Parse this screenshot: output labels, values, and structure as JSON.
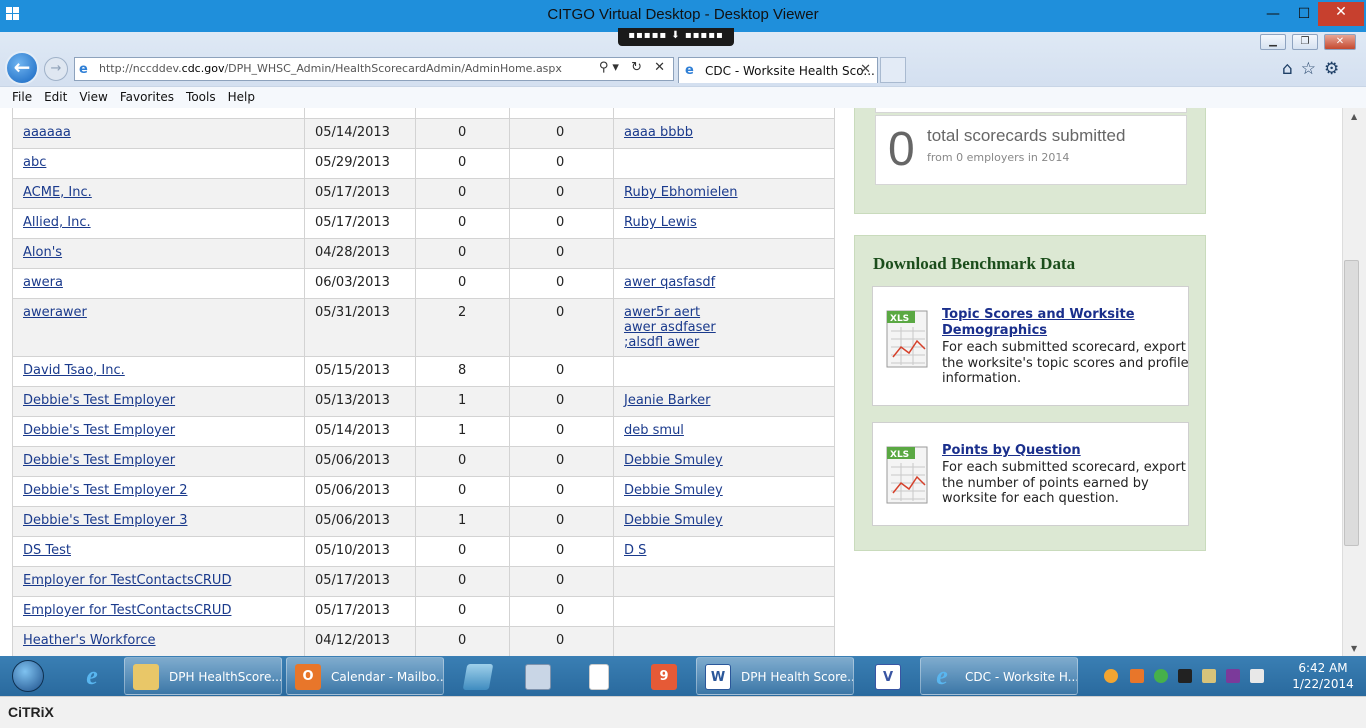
{
  "window": {
    "title": "CITGO Virtual Desktop - Desktop Viewer",
    "min_glyph": "—",
    "max_glyph": "☐",
    "close_glyph": "✕",
    "handle_glyph": "▪▪▪▪▪ ⬇ ▪▪▪▪▪"
  },
  "browser": {
    "url_prefix": "http://nccddev.",
    "url_domain": "cdc.gov",
    "url_suffix": "/DPH_WHSC_Admin/HealthScorecardAdmin/AdminHome.aspx",
    "address_icons": "⚲▾ ↻ ✕",
    "tab_label": "CDC - Worksite Health Sco...",
    "tab_close": "✕",
    "back_glyph": "←",
    "forward_glyph": "→",
    "right_icons": "⌂☆⚙",
    "menu": [
      "File",
      "Edit",
      "View",
      "Favorites",
      "Tools",
      "Help"
    ]
  },
  "employers": {
    "rows": [
      {
        "name": "aaaaaa",
        "date": "05/14/2013",
        "n1": "0",
        "n2": "0",
        "contacts": [
          "aaaa bbbb"
        ]
      },
      {
        "name": "abc",
        "date": "05/29/2013",
        "n1": "0",
        "n2": "0",
        "contacts": []
      },
      {
        "name": "ACME, Inc.",
        "date": "05/17/2013",
        "n1": "0",
        "n2": "0",
        "contacts": [
          "Ruby Ebhomielen"
        ]
      },
      {
        "name": "Allied, Inc.",
        "date": "05/17/2013",
        "n1": "0",
        "n2": "0",
        "contacts": [
          "Ruby Lewis"
        ]
      },
      {
        "name": "Alon's",
        "date": "04/28/2013",
        "n1": "0",
        "n2": "0",
        "contacts": []
      },
      {
        "name": "awera",
        "date": "06/03/2013",
        "n1": "0",
        "n2": "0",
        "contacts": [
          "awer qasfasdf"
        ]
      },
      {
        "name": "awerawer",
        "date": "05/31/2013",
        "n1": "2",
        "n2": "0",
        "contacts": [
          "awer5r aert",
          "awer asdfaser",
          ";alsdfl awer"
        ]
      },
      {
        "name": "David Tsao, Inc.",
        "date": "05/15/2013",
        "n1": "8",
        "n2": "0",
        "contacts": []
      },
      {
        "name": "Debbie's Test Employer",
        "date": "05/13/2013",
        "n1": "1",
        "n2": "0",
        "contacts": [
          "Jeanie Barker"
        ]
      },
      {
        "name": "Debbie's Test Employer",
        "date": "05/14/2013",
        "n1": "1",
        "n2": "0",
        "contacts": [
          "deb smul"
        ]
      },
      {
        "name": "Debbie's Test Employer",
        "date": "05/06/2013",
        "n1": "0",
        "n2": "0",
        "contacts": [
          "Debbie Smuley"
        ]
      },
      {
        "name": "Debbie's Test Employer 2",
        "date": "05/06/2013",
        "n1": "0",
        "n2": "0",
        "contacts": [
          "Debbie Smuley"
        ]
      },
      {
        "name": "Debbie's Test Employer 3",
        "date": "05/06/2013",
        "n1": "1",
        "n2": "0",
        "contacts": [
          "Debbie Smuley"
        ]
      },
      {
        "name": "DS Test",
        "date": "05/10/2013",
        "n1": "0",
        "n2": "0",
        "contacts": [
          "D S"
        ]
      },
      {
        "name": "Employer for TestContactsCRUD",
        "date": "05/17/2013",
        "n1": "0",
        "n2": "0",
        "contacts": []
      },
      {
        "name": "Employer for TestContactsCRUD",
        "date": "05/17/2013",
        "n1": "0",
        "n2": "0",
        "contacts": []
      },
      {
        "name": "Heather's Workforce",
        "date": "04/12/2013",
        "n1": "0",
        "n2": "0",
        "contacts": []
      }
    ]
  },
  "stats": {
    "count": "0",
    "title": "total scorecards submitted",
    "subtitle": "from 0 employers in 2014"
  },
  "benchmark": {
    "heading": "Download Benchmark Data",
    "icon_label": "XLS",
    "items": [
      {
        "title": "Topic Scores and Worksite Demographics",
        "desc": "For each submitted scorecard, export the worksite's topic scores and profile information."
      },
      {
        "title": "Points by Question",
        "desc": "For each submitted scorecard, export the number of points earned by worksite for each question."
      }
    ]
  },
  "taskbar": {
    "items": [
      {
        "id": "tb-folder",
        "label": "DPH HealthScore..."
      },
      {
        "id": "tb-outlook",
        "label": "Calendar - Mailbo..."
      },
      {
        "id": "tb-word",
        "label": "DPH Health Score..."
      },
      {
        "id": "tb-ie-active",
        "label": "CDC - Worksite H..."
      }
    ],
    "icons": {
      "ie": "e",
      "outlook": "O",
      "word": "W",
      "visio": "V",
      "check_badge": "9"
    },
    "clock_time": "6:42 AM",
    "clock_date": "1/22/2014"
  },
  "colors": {
    "citrix_title": "#1f8fdb",
    "sidebar_green": "#dce8d3",
    "link": "#1a3a8c",
    "heading_green": "#1b4d1b"
  },
  "citrix": {
    "logo": "CiTRiX"
  }
}
